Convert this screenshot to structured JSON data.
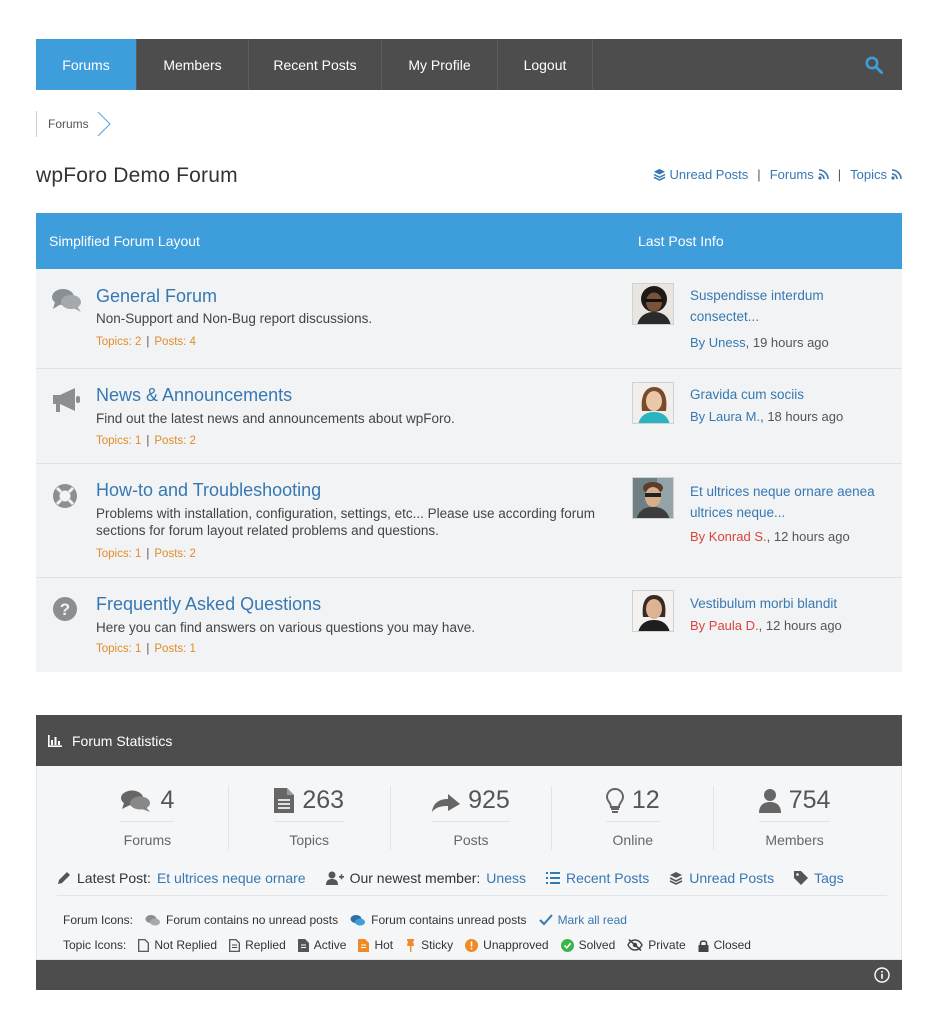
{
  "nav": {
    "items": [
      "Forums",
      "Members",
      "Recent Posts",
      "My Profile",
      "Logout"
    ],
    "active": "Forums",
    "search_icon": "search-icon"
  },
  "breadcrumb": {
    "item": "Forums"
  },
  "page": {
    "title": "wpForo Demo Forum",
    "links": {
      "unread": "Unread Posts",
      "forums": "Forums",
      "topics": "Topics",
      "sep": "|"
    }
  },
  "table": {
    "header_left": "Simplified Forum Layout",
    "header_right": "Last Post Info",
    "forums": [
      {
        "icon": "comments-icon",
        "title": "General Forum",
        "desc": "Non-Support and Non-Bug report discussions.",
        "topics": "Topics: 2",
        "posts": "Posts: 4",
        "last_title": "Suspendisse interdum consectet...",
        "by": "By Uness",
        "time": ", 19 hours ago"
      },
      {
        "icon": "bullhorn-icon",
        "title": "News & Announcements",
        "desc": "Find out the latest news and announcements about wpForo.",
        "topics": "Topics: 1",
        "posts": "Posts: 2",
        "last_title": "Gravida cum sociis",
        "by": "By Laura M.",
        "time": ", 18 hours ago"
      },
      {
        "icon": "life-ring-icon",
        "title": "How-to and Troubleshooting",
        "desc": "Problems with installation, configuration, settings, etc... Please use according forum sections for forum layout related problems and questions.",
        "topics": "Topics: 1",
        "posts": "Posts: 2",
        "last_title": "Et ultrices neque ornare aenea ultrices neque...",
        "by": "By Konrad S.",
        "time": ", 12 hours ago"
      },
      {
        "icon": "question-circle-icon",
        "title": "Frequently Asked Questions",
        "desc": "Here you can find answers on various questions you may have.",
        "topics": "Topics: 1",
        "posts": "Posts: 1",
        "last_title": "Vestibulum morbi blandit",
        "by": "By Paula D.",
        "time": ", 12 hours ago"
      }
    ]
  },
  "stats": {
    "title": "Forum Statistics",
    "counters": [
      {
        "value": "4",
        "label": "Forums",
        "icon": "comments-icon"
      },
      {
        "value": "263",
        "label": "Topics",
        "icon": "file-icon"
      },
      {
        "value": "925",
        "label": "Posts",
        "icon": "reply-icon"
      },
      {
        "value": "12",
        "label": "Online",
        "icon": "lightbulb-icon"
      },
      {
        "value": "754",
        "label": "Members",
        "icon": "user-icon"
      }
    ],
    "latest_label": "Latest Post:",
    "latest_link": "Et ultrices neque ornare",
    "newest_label": "Our newest member:",
    "newest_link": "Uness",
    "recent": "Recent Posts",
    "unread": "Unread Posts",
    "tags": "Tags",
    "forum_icons_label": "Forum Icons:",
    "no_unread": "Forum contains no unread posts",
    "has_unread": "Forum contains unread posts",
    "mark_read": "Mark all read",
    "topic_icons_label": "Topic Icons:",
    "topic_icons": [
      "Not Replied",
      "Replied",
      "Active",
      "Hot",
      "Sticky",
      "Unapproved",
      "Solved",
      "Private",
      "Closed"
    ]
  },
  "colors": {
    "accent": "#3e9ddb",
    "dark": "#4d4d4d",
    "link": "#3778b3",
    "orange": "#e38b2d",
    "red": "#d9443c",
    "green": "#3bb54a"
  }
}
